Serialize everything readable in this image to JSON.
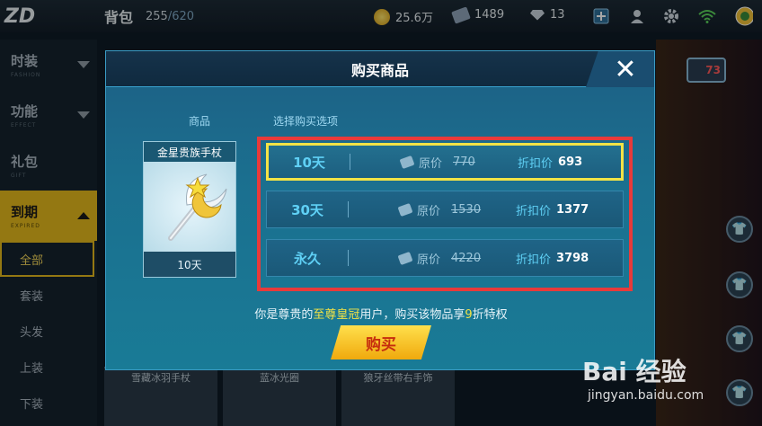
{
  "topbar": {
    "logo": "ZD",
    "bag_title": "背包",
    "bag_used": "255",
    "bag_max": "/620",
    "coins": "25.6万",
    "tickets": "1489",
    "gems": "13",
    "icons": [
      "plus-icon",
      "profile-icon",
      "gear-icon",
      "wifi-icon",
      "avatar"
    ]
  },
  "sidebar": {
    "categories": [
      {
        "label": "时装",
        "sub": "FASHION"
      },
      {
        "label": "功能",
        "sub": "EFFECT"
      },
      {
        "label": "礼包",
        "sub": "GIFT"
      },
      {
        "label": "到期",
        "sub": "EXPIRED"
      }
    ],
    "subitems": [
      "全部",
      "套装",
      "头发",
      "上装",
      "下装"
    ]
  },
  "background": {
    "slots": [
      "雪藏冰羽手杖",
      "蓝冰光圈",
      "狼牙丝带右手饰"
    ],
    "level": "73"
  },
  "dialog": {
    "title": "购买商品",
    "close": "✕",
    "label_item": "商品",
    "label_options": "选择购买选项",
    "item_name": "金星贵族手杖",
    "item_duration": "10天",
    "original_label": "原价",
    "discount_label": "折扣价",
    "options": [
      {
        "duration": "10天",
        "original": "770",
        "discount": "693"
      },
      {
        "duration": "30天",
        "original": "1530",
        "discount": "1377"
      },
      {
        "duration": "永久",
        "original": "4220",
        "discount": "3798"
      }
    ],
    "vip_pre": "你是尊贵的",
    "vip_name": "至尊皇冠",
    "vip_mid": "用户，购买该物品享",
    "vip_num": "9",
    "vip_post": "折特权",
    "buy_label": "购买"
  },
  "watermark": {
    "logo": "Bai 经验",
    "url": "jingyan.baidu.com"
  },
  "colors": {
    "accent": "#e4b91c",
    "highlight_border": "#f3e346",
    "annotation_red": "#e83a3a",
    "dialog_bg": "#1b6f8f"
  }
}
